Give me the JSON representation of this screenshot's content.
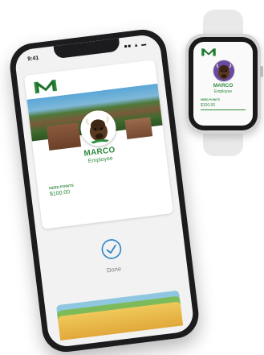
{
  "phone": {
    "status": {
      "time": "9:41",
      "icons": "■■ ▲ ▬"
    },
    "card": {
      "name": "MARCO",
      "role": "Employee",
      "points_label": "HERD POINTS",
      "points_value": "$100.00"
    },
    "done_label": "Done"
  },
  "watch": {
    "name": "MARCO",
    "role": "Employee",
    "points_label": "HERD POINTS",
    "points_value": "$100.00"
  },
  "colors": {
    "brand_green": "#2e8b3e",
    "check_blue": "#2b86c8"
  },
  "icons": [
    "marshall-m-logo",
    "bison-mascot-avatar",
    "checkmark-circle-icon",
    "signal-icon",
    "wifi-icon",
    "battery-icon"
  ]
}
